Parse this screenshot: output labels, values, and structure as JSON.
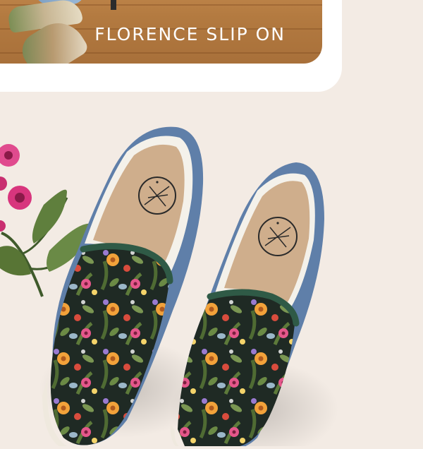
{
  "hero": {
    "title": "FLORENCE SLIP ON"
  },
  "product": {
    "name": "floral slip-on sneakers",
    "colors": {
      "background": "#f3ebe4",
      "trim": "#5f7fa9",
      "collar": "#2f5a46",
      "insole": "#cfae8c",
      "sole": "#efe9de",
      "print_base": "#1f2a24"
    }
  },
  "icons": [
    "brand-logo-icon",
    "flower-sprig-icon"
  ]
}
